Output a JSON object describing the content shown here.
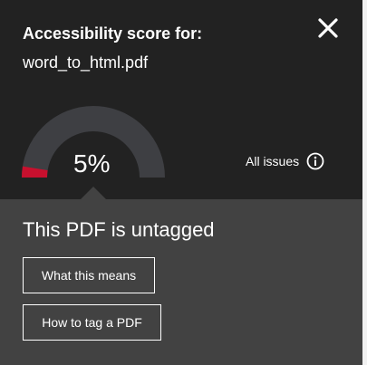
{
  "panel": {
    "title_line1": "Accessibility score for:",
    "file_name": "word_to_html.pdf",
    "close_icon": "close-icon"
  },
  "score": {
    "value_label": "5%",
    "fraction": 0.05,
    "accent_color": "#c8102e",
    "track_color": "#3e3f43"
  },
  "issues": {
    "label": "All issues",
    "icon": "info-icon"
  },
  "status": {
    "text": "This PDF is untagged"
  },
  "buttons": {
    "what_this_means": "What this means",
    "how_to_tag": "How to tag a PDF"
  }
}
